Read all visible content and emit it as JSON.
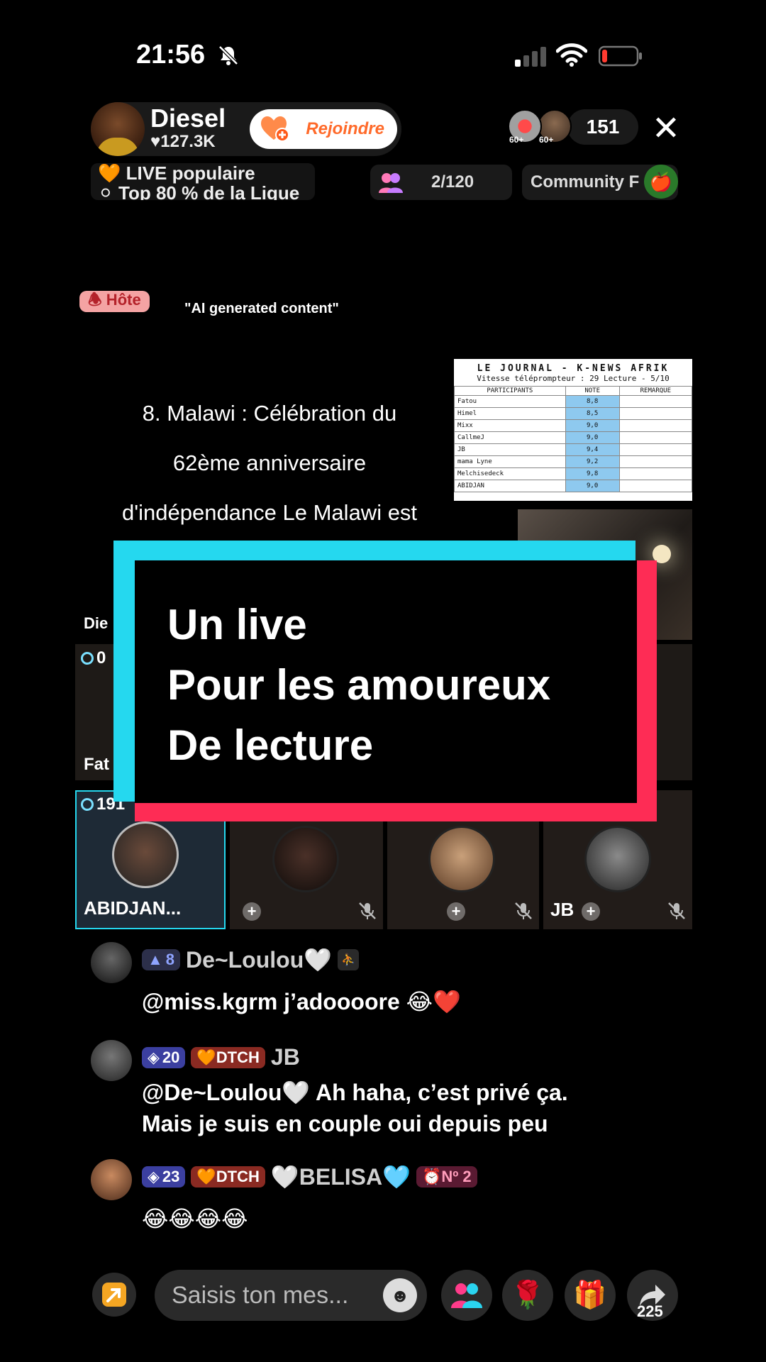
{
  "status_bar": {
    "time": "21:56"
  },
  "header": {
    "host_name": "Diesel",
    "host_likes": "♥127.3K",
    "join_label": "Rejoindre",
    "viewer_badges": [
      "60+",
      "60+"
    ],
    "viewer_count": "151",
    "popular_line1": "🧡 LIVE populaire",
    "popular_line2": "⚪ Top 80 % de la Ligue",
    "guests": "2/120",
    "community": "Community F"
  },
  "stream": {
    "host_badge": "🕭 Hôte",
    "ai_note": "\"AI generated content\"",
    "teleprompter_lines": [
      "8. Malawi : Célébration du",
      "62ème anniversaire",
      "d'indépendance Le Malawi est"
    ],
    "journal": {
      "title": "LE JOURNAL - K-NEWS AFRIK",
      "subtitle": "Vitesse téléprompteur : 29   Lecture - 5/10",
      "headers": [
        "PARTICIPANTS",
        "NOTE",
        "REMARQUE"
      ],
      "rows": [
        {
          "name": "Fatou",
          "note": "8,8"
        },
        {
          "name": "Himel",
          "note": "8,5"
        },
        {
          "name": "Mixx",
          "note": "9,0"
        },
        {
          "name": "CallmeJ",
          "note": "9,0"
        },
        {
          "name": "JB",
          "note": "9,4"
        },
        {
          "name": "mama Lyne",
          "note": "9,2"
        },
        {
          "name": "Melchisedeck",
          "note": "9,8"
        },
        {
          "name": "ABIDJAN",
          "note": "9,0"
        }
      ]
    }
  },
  "banner": {
    "lines": [
      "Un live",
      "Pour les amoureux",
      "De lecture"
    ]
  },
  "grid": {
    "top_label": "Die",
    "top_score": "0",
    "left_label": "Fat",
    "tiles": [
      {
        "score": "191",
        "name": "ABIDJAN..."
      },
      {
        "score": "",
        "name": ""
      },
      {
        "score": "",
        "name": ""
      },
      {
        "score": "",
        "name": "JB"
      }
    ]
  },
  "comments": [
    {
      "level": "8",
      "fan": "",
      "user": "De~Loulou🤍",
      "text": "@miss.kgrm j’adoooore 😂❤️"
    },
    {
      "level": "20",
      "fan": "🧡DTCH",
      "user": "JB",
      "text_line1": "@De~Loulou🤍 Ah haha, c’est privé ça.",
      "text_line2": "Mais je suis en couple oui depuis peu"
    },
    {
      "level": "23",
      "fan": "🧡DTCH",
      "user": "🤍BELISA🩵",
      "rank": "Nº 2",
      "text": "😂😂😂😂"
    }
  ],
  "bottom_bar": {
    "input_placeholder": "Saisis ton mes...",
    "share_count": "225"
  }
}
